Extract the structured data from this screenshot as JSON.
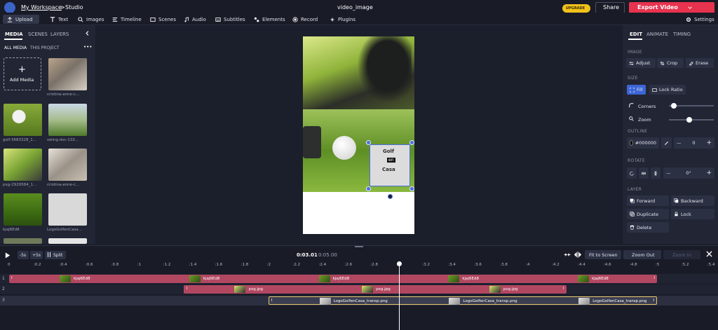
{
  "header": {
    "breadcrumb_workspace": "My Workspace",
    "breadcrumb_sep": ">",
    "breadcrumb_studio": "Studio",
    "project_title": "video_image",
    "upgrade_label": "UPGRADE",
    "share_label": "Share",
    "export_label": "Export Video"
  },
  "toolbar": {
    "items": [
      "Upload",
      "Text",
      "Images",
      "Timeline",
      "Scenes",
      "Audio",
      "Subtitles",
      "Elements",
      "Record",
      "Plugins"
    ],
    "settings_label": "Settings"
  },
  "left_panel": {
    "tabs": [
      "MEDIA",
      "SCENES",
      "LAYERS"
    ],
    "subtabs": [
      "ALL MEDIA",
      "THIS PROJECT"
    ],
    "more": "•••",
    "add_media_plus": "+",
    "add_media_label": "Add Media",
    "items": [
      "cristina-anne-c...",
      "golf-3683328_1...",
      "swing-dsc-133...",
      "pxg-2929584_1...",
      "cristina-anne-c...",
      "kjaj6Ed8",
      "LogoGolfenCasa..."
    ]
  },
  "logo": {
    "line1": "Golf",
    "line2": "en",
    "line3": "Casa"
  },
  "right_panel": {
    "tabs": [
      "EDIT",
      "ANIMATE",
      "TIMING"
    ],
    "image_section": "IMAGE",
    "adjust": "Adjust",
    "crop": "Crop",
    "erase": "Erase",
    "size_section": "SIZE",
    "fill": "Fill",
    "lock_ratio": "Lock Ratio",
    "corners": "Corners",
    "zoom": "Zoom",
    "corners_value": 0.05,
    "zoom_value": 0.45,
    "outline_section": "OUTLINE",
    "outline_color": "#000000",
    "outline_minus": "—",
    "outline_value": "0",
    "outline_plus": "+",
    "rotate_section": "ROTATE",
    "rotate_minus": "—",
    "rotate_value": "0°",
    "rotate_plus": "+",
    "layer_section": "LAYER",
    "forward": "Forward",
    "backward": "Backward",
    "duplicate": "Duplicate",
    "lock": "Lock",
    "delete": "Delete"
  },
  "timeline": {
    "minus5": "-5s",
    "plus5": "+5s",
    "split": "Split",
    "current_time": "0:03.01",
    "separator": "/",
    "total_time": "0:05.00",
    "fit_to_screen": "Fit to Screen",
    "zoom_out": "Zoom Out",
    "zoom_in": "Zoom In",
    "ticks": [
      "0",
      ":0.2",
      ":0.4",
      ":0.6",
      ":0.8",
      ":1",
      ":1.2",
      ":1.4",
      ":1.6",
      ":1.8",
      ":2",
      ":2.2",
      ":2.4",
      ":2.6",
      ":2.8",
      ":3",
      ":3.2",
      ":3.4",
      ":3.6",
      ":3.8",
      ":4",
      ":4.2",
      ":4.4",
      ":4.6",
      ":4.8",
      ":5",
      ":5.2",
      ":5.4"
    ],
    "rows": [
      {
        "num": "1",
        "label": "kjaj6Ed8",
        "start": 0,
        "end": 5
      },
      {
        "num": "2",
        "label": "pxg.jpg",
        "start": 1.35,
        "end": 4.3
      },
      {
        "num": "3",
        "label": "LogoGolfenCasa_transp.png",
        "start": 2.0,
        "end": 5.0
      }
    ],
    "playhead_time": 3.01,
    "clip_edge": "I"
  },
  "colors": {
    "accent_blue": "#4a6ee0",
    "export_red": "#e8334f",
    "upgrade_yellow": "#f2c21b",
    "track1": "#b24761",
    "track3_border": "#e5c56b"
  }
}
